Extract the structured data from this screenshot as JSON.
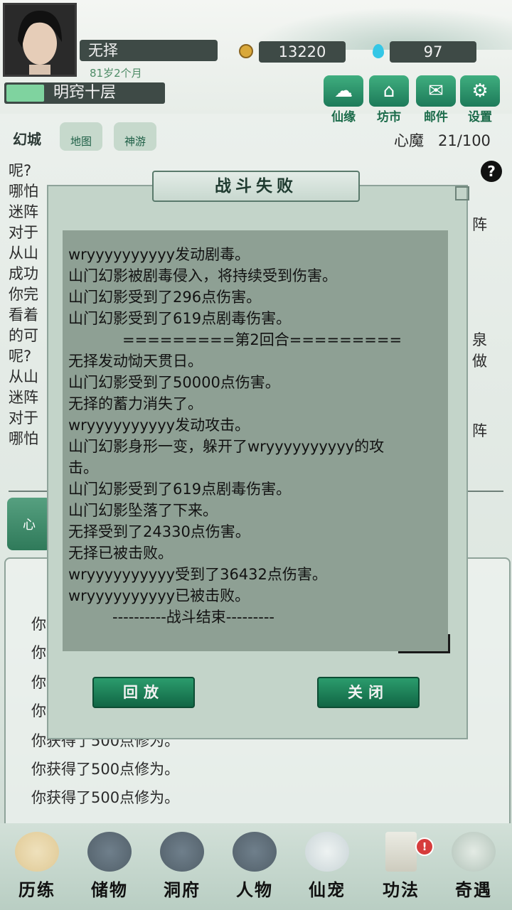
{
  "header": {
    "player_name": "无择",
    "age": "81岁2个月",
    "realm": "明窍十层",
    "realm_progress": 0.24,
    "coins": "13220",
    "gems": "97",
    "buttons": [
      {
        "label": "仙缘",
        "icon": "cloud-icon"
      },
      {
        "label": "坊市",
        "icon": "market-icon"
      },
      {
        "label": "邮件",
        "icon": "mail-icon"
      },
      {
        "label": "设置",
        "icon": "gear-icon"
      }
    ]
  },
  "subbar": {
    "location": "幻城",
    "map_label": "地图",
    "travel_label": "神游",
    "demon_label": "心魔",
    "demon_value": "21/100"
  },
  "background_log": {
    "lines": [
      "呢?",
      "哪怕",
      "迷阵",
      "对于",
      "从山",
      "成功",
      "你完",
      "看着",
      "的可",
      "呢?",
      "从山",
      "迷阵",
      "对于",
      "哪怕"
    ],
    "right_chars": [
      "阵",
      "泉",
      "做",
      "阵"
    ],
    "xin_label": "心",
    "gains": [
      "你",
      "你",
      "你",
      "你",
      "你获得了500点修为。",
      "你获得了500点修为。",
      "你获得了500点修为。"
    ]
  },
  "modal": {
    "title": "战斗失败",
    "log_lines": [
      "wryyyyyyyyyy发动剧毒。",
      "山门幻影被剧毒侵入，将持续受到伤害。",
      "山门幻影受到了296点伤害。",
      "山门幻影受到了619点剧毒伤害。",
      "=========第2回合=========",
      "无择发动恸天贯日。",
      "山门幻影受到了50000点伤害。",
      "无择的蓄力消失了。",
      "wryyyyyyyyyy发动攻击。",
      "山门幻影身形一变，躲开了wryyyyyyyyyy的攻",
      "击。",
      "山门幻影受到了619点剧毒伤害。",
      "山门幻影坠落了下来。",
      "无择受到了24330点伤害。",
      "无择已被击败。",
      "wryyyyyyyyyy受到了36432点伤害。",
      "wryyyyyyyyyy已被击败。",
      "----------战斗结束---------"
    ],
    "replay_label": "回放",
    "close_label": "关闭"
  },
  "bottom_nav": [
    {
      "label": "历练",
      "icon": "training-icon"
    },
    {
      "label": "储物",
      "icon": "storage-icon"
    },
    {
      "label": "洞府",
      "icon": "cave-icon"
    },
    {
      "label": "人物",
      "icon": "character-icon"
    },
    {
      "label": "仙宠",
      "icon": "pet-icon"
    },
    {
      "label": "功法",
      "icon": "skill-icon"
    },
    {
      "label": "奇遇",
      "icon": "adventure-icon"
    }
  ],
  "badges": {
    "skill_alert": "!"
  }
}
